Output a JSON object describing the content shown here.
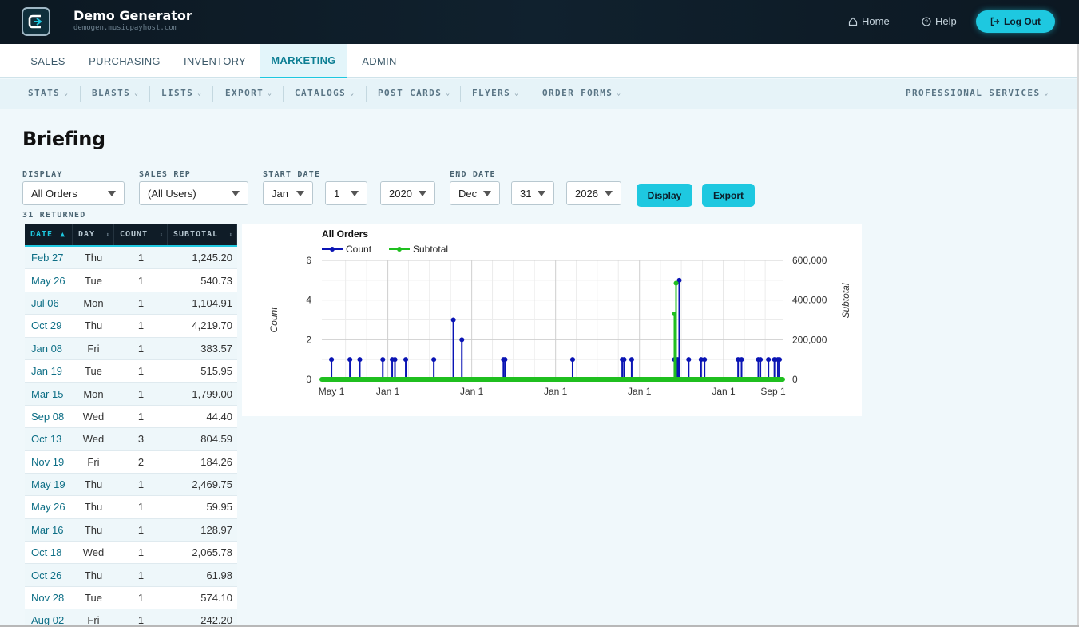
{
  "header": {
    "brand_title": "Demo Generator",
    "brand_sub": "demogen.musicpayhost.com",
    "home_label": "Home",
    "help_label": "Help",
    "logout_label": "Log Out",
    "accent": "#1ec8e0"
  },
  "main_tabs": [
    "SALES",
    "PURCHASING",
    "INVENTORY",
    "MARKETING",
    "ADMIN"
  ],
  "active_tab": "MARKETING",
  "sub_nav": [
    "STATS",
    "BLASTS",
    "LISTS",
    "EXPORT",
    "CATALOGS",
    "POST CARDS",
    "FLYERS",
    "ORDER FORMS",
    "PROFESSIONAL SERVICES"
  ],
  "page": {
    "title": "Briefing",
    "returned": "31 RETURNED"
  },
  "filters": {
    "display_label": "DISPLAY",
    "display_value": "All Orders",
    "rep_label": "SALES REP",
    "rep_value": "(All Users)",
    "start_label": "START DATE",
    "start_month": "Jan",
    "start_day": "1",
    "start_year": "2020",
    "end_label": "END DATE",
    "end_month": "Dec",
    "end_day": "31",
    "end_year": "2026",
    "display_btn": "Display",
    "export_btn": "Export"
  },
  "table": {
    "columns": [
      "DATE",
      "DAY",
      "COUNT",
      "SUBTOTAL"
    ],
    "sorted_column": "DATE",
    "rows": [
      [
        "Feb 27",
        "Thu",
        "1",
        "1,245.20"
      ],
      [
        "May 26",
        "Tue",
        "1",
        "540.73"
      ],
      [
        "Jul 06",
        "Mon",
        "1",
        "1,104.91"
      ],
      [
        "Oct 29",
        "Thu",
        "1",
        "4,219.70"
      ],
      [
        "Jan 08",
        "Fri",
        "1",
        "383.57"
      ],
      [
        "Jan 19",
        "Tue",
        "1",
        "515.95"
      ],
      [
        "Mar 15",
        "Mon",
        "1",
        "1,799.00"
      ],
      [
        "Sep 08",
        "Wed",
        "1",
        "44.40"
      ],
      [
        "Oct 13",
        "Wed",
        "3",
        "804.59"
      ],
      [
        "Nov 19",
        "Fri",
        "2",
        "184.26"
      ],
      [
        "May 19",
        "Thu",
        "1",
        "2,469.75"
      ],
      [
        "May 26",
        "Thu",
        "1",
        "59.95"
      ],
      [
        "Mar 16",
        "Thu",
        "1",
        "128.97"
      ],
      [
        "Oct 18",
        "Wed",
        "1",
        "2,065.78"
      ],
      [
        "Oct 26",
        "Thu",
        "1",
        "61.98"
      ],
      [
        "Nov 28",
        "Tue",
        "1",
        "574.10"
      ],
      [
        "Aug 02",
        "Fri",
        "1",
        "242.20"
      ]
    ]
  },
  "chart_data": {
    "type": "line",
    "title": "All Orders",
    "xlabel": "",
    "ylabel": "Count",
    "y2label": "Subtotal",
    "ylim": [
      0,
      6
    ],
    "y2lim": [
      0,
      600000
    ],
    "yticks": [
      "0",
      "2",
      "4",
      "6"
    ],
    "y2ticks": [
      "0",
      "200,000",
      "400,000",
      "600,000"
    ],
    "xticks": [
      "May 1",
      "Jan 1",
      "Jan 1",
      "Jan 1",
      "Jan 1",
      "Jan 1",
      "Sep 1"
    ],
    "legend": "top-left",
    "grid": true,
    "series": [
      {
        "name": "Count",
        "color": "#0a14b4",
        "x": [
          "2020-05-01",
          "2020-07-20",
          "2020-09-01",
          "2020-12-10",
          "2021-01-20",
          "2021-02-01",
          "2021-03-20",
          "2021-07-20",
          "2021-10-13",
          "2021-11-19",
          "2022-05-19",
          "2022-05-26",
          "2023-03-16",
          "2023-10-18",
          "2023-10-26",
          "2023-11-28",
          "2024-06-01",
          "2024-06-08",
          "2024-06-15",
          "2024-06-22",
          "2024-08-02",
          "2024-09-25",
          "2024-10-10",
          "2025-03-05",
          "2025-03-20",
          "2025-06-01",
          "2025-06-10",
          "2025-07-15",
          "2025-08-10",
          "2025-08-25",
          "2025-09-01"
        ],
        "values": [
          1,
          1,
          1,
          1,
          1,
          1,
          1,
          1,
          3,
          2,
          1,
          1,
          1,
          1,
          1,
          1,
          1,
          1,
          1,
          5,
          1,
          1,
          1,
          1,
          1,
          1,
          1,
          1,
          1,
          1,
          1
        ]
      },
      {
        "name": "Subtotal",
        "color": "#1fbf1f",
        "x": [
          "2020-05-01",
          "2021-10-13",
          "2024-06-15",
          "2024-06-22",
          "2025-09-01"
        ],
        "values": [
          1245,
          805,
          330000,
          485000,
          242
        ]
      }
    ]
  }
}
